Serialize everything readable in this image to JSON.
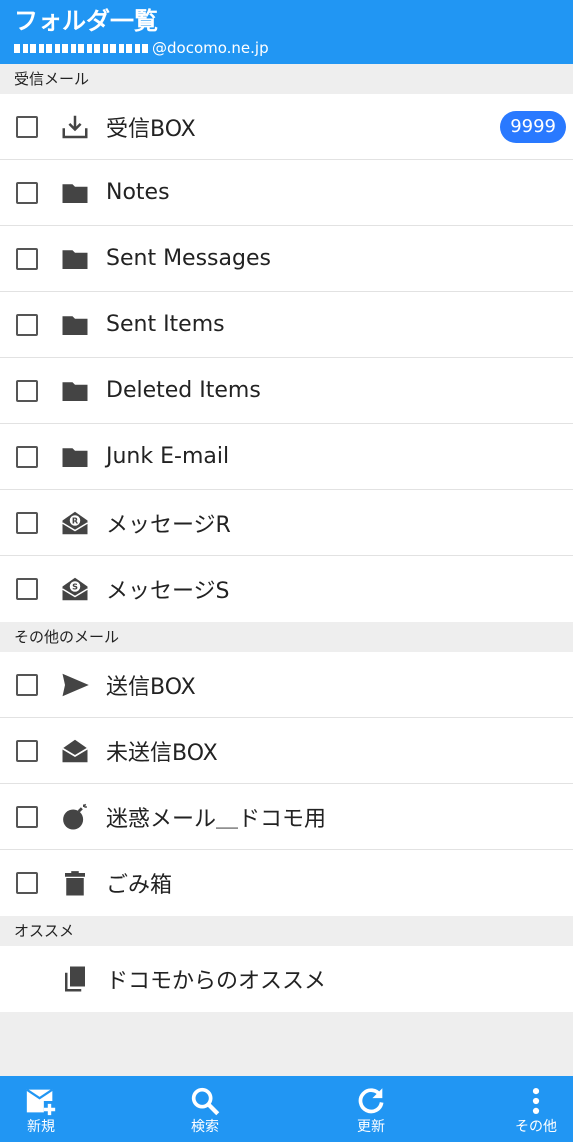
{
  "header": {
    "title": "フォルダ一覧",
    "account_suffix": "@docomo.ne.jp"
  },
  "sections": {
    "received": "受信メール",
    "other": "その他のメール",
    "recommend": "オススメ"
  },
  "folders_received": [
    {
      "label": "受信BOX",
      "icon": "inbox-download-icon",
      "badge": "9999"
    },
    {
      "label": "Notes",
      "icon": "folder-icon"
    },
    {
      "label": "Sent Messages",
      "icon": "folder-icon"
    },
    {
      "label": "Sent Items",
      "icon": "folder-icon"
    },
    {
      "label": "Deleted Items",
      "icon": "folder-icon"
    },
    {
      "label": "Junk E-mail",
      "icon": "folder-icon"
    },
    {
      "label": "メッセージR",
      "icon": "message-r-envelope-icon"
    },
    {
      "label": "メッセージS",
      "icon": "message-s-envelope-icon"
    }
  ],
  "folders_other": [
    {
      "label": "送信BOX",
      "icon": "send-icon"
    },
    {
      "label": "未送信BOX",
      "icon": "open-envelope-icon"
    },
    {
      "label": "迷惑メール＿ドコモ用",
      "icon": "bomb-icon"
    },
    {
      "label": "ごみ箱",
      "icon": "trash-icon"
    }
  ],
  "recommend_item": {
    "label": "ドコモからのオススメ",
    "icon": "copy-pages-icon"
  },
  "bottom_nav": {
    "new": "新規",
    "search": "検索",
    "refresh": "更新",
    "more": "その他"
  },
  "colors": {
    "header": "#2196f3",
    "badge": "#2979ff",
    "icon": "#444444"
  }
}
